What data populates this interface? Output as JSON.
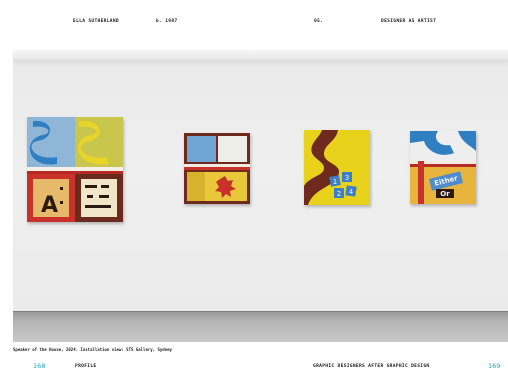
{
  "header": {
    "name": "ELLA SUTHERLAND",
    "born": "b. 1987",
    "section_number": "05.",
    "section_title": "DESIGNER AS ARTIST"
  },
  "image": {
    "caption": "Speaker of the House, 2024. Installation view: STS Gallery, Sydney"
  },
  "artworks": [
    {
      "id": "painting-1",
      "letter": "A"
    },
    {
      "id": "painting-2"
    },
    {
      "id": "painting-3",
      "tiles": [
        "1",
        "3",
        "2",
        "4"
      ]
    },
    {
      "id": "painting-4",
      "words": [
        "Either",
        "Or"
      ]
    }
  ],
  "footer": {
    "left_page_number": "168",
    "left_label": "PROFILE",
    "right_label": "GRAPHIC DESIGNERS AFTER GRAPHIC DESIGN",
    "right_page_number": "169"
  },
  "colors": {
    "page_number": "#28a6c8",
    "wall": "#ececec",
    "floor": "#a8a8a8"
  }
}
